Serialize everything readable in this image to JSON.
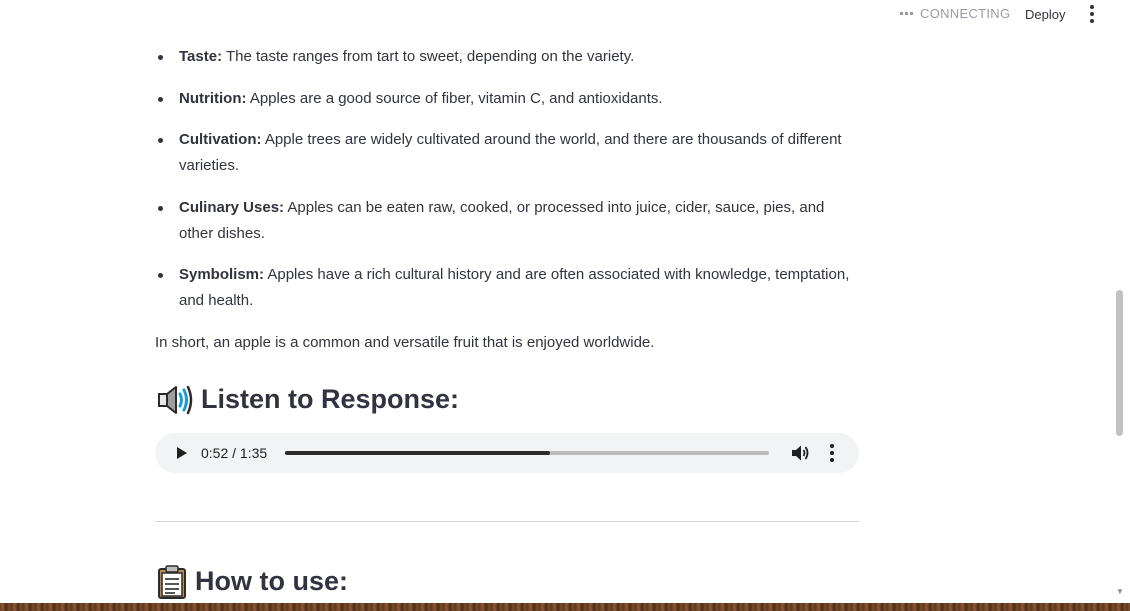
{
  "header": {
    "status": "CONNECTING",
    "deploy_label": "Deploy",
    "menu_icon": "kebab-menu-icon"
  },
  "bullets": [
    {
      "term": "Taste:",
      "text": " The taste ranges from tart to sweet, depending on the variety."
    },
    {
      "term": "Nutrition:",
      "text": " Apples are a good source of fiber, vitamin C, and antioxidants."
    },
    {
      "term": "Cultivation:",
      "text": " Apple trees are widely cultivated around the world, and there are thousands of different varieties."
    },
    {
      "term": "Culinary Uses:",
      "text": " Apples can be eaten raw, cooked, or processed into juice, cider, sauce, pies, and other dishes."
    },
    {
      "term": "Symbolism:",
      "text": " Apples have a rich cultural history and are often associated with knowledge, temptation, and health."
    }
  ],
  "summary": "In short, an apple is a common and versatile fruit that is enjoyed worldwide.",
  "listen": {
    "title": "Listen to Response:",
    "icon": "speaker-icon"
  },
  "audio": {
    "time": "0:52 / 1:35",
    "progress_fraction": 0.547,
    "icons": [
      "play-icon",
      "volume-icon",
      "more-options-icon"
    ]
  },
  "howto": {
    "title": "How to use:",
    "icon": "clipboard-icon"
  },
  "colors": {
    "text": "#31333f",
    "status": "#9a9ba3",
    "audio_bg": "#f1f3f4",
    "accent_blue": "#1a9bd7"
  }
}
